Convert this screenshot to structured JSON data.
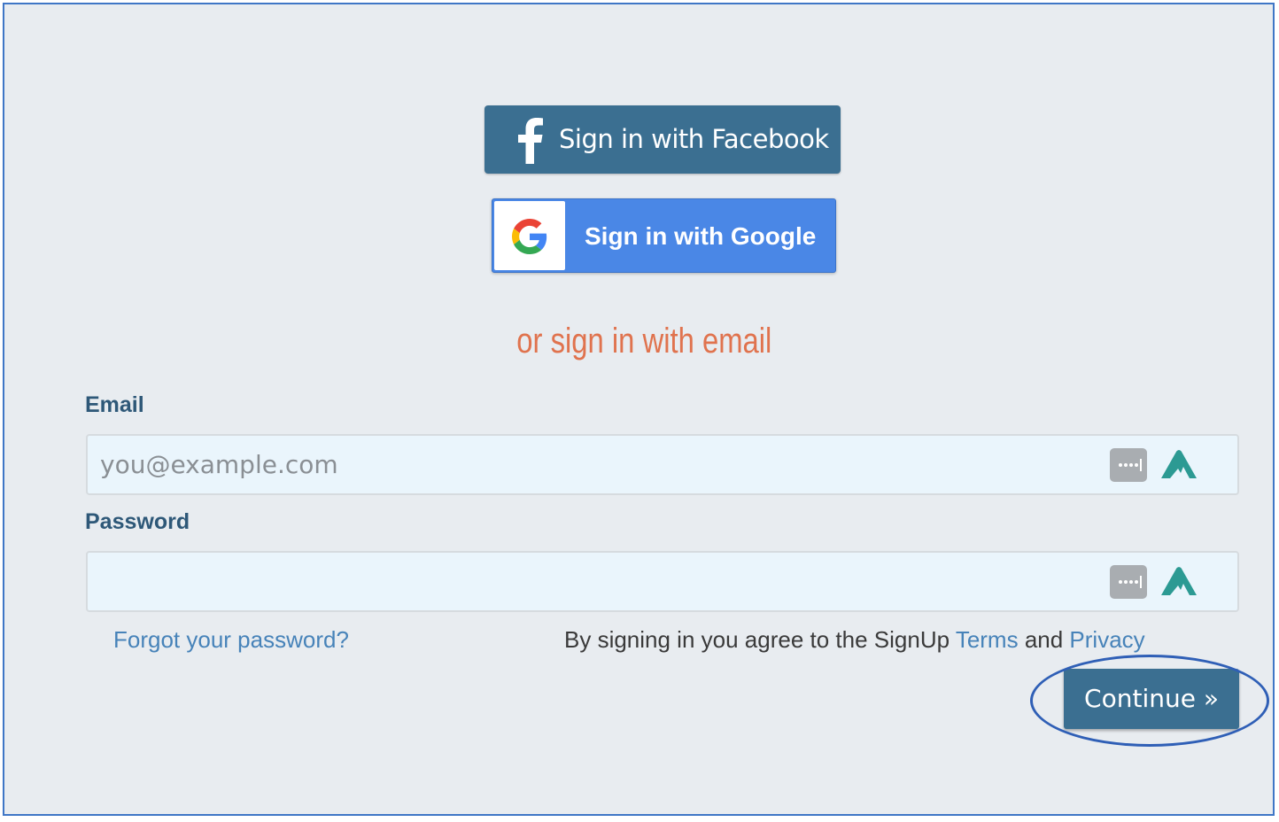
{
  "social": {
    "facebook_label": "Sign in with Facebook",
    "google_label": "Sign in with Google"
  },
  "divider": {
    "text": "or sign in with email"
  },
  "form": {
    "email_label": "Email",
    "email_placeholder": "you@example.com",
    "email_value": "",
    "password_label": "Password",
    "password_value": ""
  },
  "links": {
    "forgot_password": "Forgot your password?",
    "agree_prefix": "By signing in you agree to the SignUp ",
    "terms": "Terms",
    "agree_and": " and ",
    "privacy": "Privacy"
  },
  "actions": {
    "continue_label": "Continue »"
  },
  "icons": {
    "facebook": "facebook-f-icon",
    "google": "google-g-icon",
    "password_manager": "dots-icon",
    "vpn": "nord-mountain-icon"
  },
  "colors": {
    "primary_button": "#3b6f91",
    "google_blue": "#4a87e6",
    "accent_orange": "#e0734e",
    "label_blue": "#2e5878",
    "link_blue": "#4783b9",
    "page_bg": "#e8ecf0",
    "input_bg": "#eaf5fc",
    "highlight": "#2f5fb6"
  }
}
